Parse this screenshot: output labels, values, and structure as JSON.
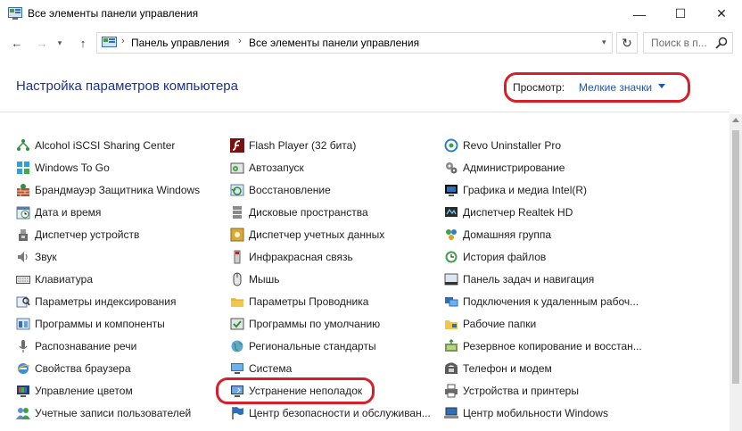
{
  "window": {
    "title": "Все элементы панели управления",
    "minimize": "—",
    "maximize": "☐",
    "close": "✕"
  },
  "nav": {
    "back": "←",
    "forward": "→",
    "recent": "▾",
    "up": "↑",
    "breadcrumb": [
      "Панель управления",
      "Все элементы панели управления"
    ],
    "separator": "›",
    "address_dropdown": "▾",
    "refresh": "↻",
    "search_placeholder": "Поиск в п..."
  },
  "header": {
    "title": "Настройка параметров компьютера",
    "view_label": "Просмотр:",
    "view_value": "Мелкие значки"
  },
  "columns": [
    [
      {
        "label": "Alcohol iSCSI Sharing Center",
        "icon": "network-share-icon"
      },
      {
        "label": "Windows To Go",
        "icon": "windows-to-go-icon"
      },
      {
        "label": "Брандмауэр Защитника Windows",
        "icon": "firewall-icon"
      },
      {
        "label": "Дата и время",
        "icon": "clock-icon"
      },
      {
        "label": "Диспетчер устройств",
        "icon": "device-manager-icon"
      },
      {
        "label": "Звук",
        "icon": "speaker-icon"
      },
      {
        "label": "Клавиатура",
        "icon": "keyboard-icon"
      },
      {
        "label": "Параметры индексирования",
        "icon": "indexing-icon"
      },
      {
        "label": "Программы и компоненты",
        "icon": "programs-icon"
      },
      {
        "label": "Распознавание речи",
        "icon": "microphone-icon"
      },
      {
        "label": "Свойства браузера",
        "icon": "browser-icon"
      },
      {
        "label": "Управление цветом",
        "icon": "color-management-icon"
      },
      {
        "label": "Учетные записи пользователей",
        "icon": "users-icon"
      }
    ],
    [
      {
        "label": "Flash Player (32 бита)",
        "icon": "flash-icon"
      },
      {
        "label": "Автозапуск",
        "icon": "autoplay-icon"
      },
      {
        "label": "Восстановление",
        "icon": "recovery-icon"
      },
      {
        "label": "Дисковые пространства",
        "icon": "storage-spaces-icon"
      },
      {
        "label": "Диспетчер учетных данных",
        "icon": "credential-icon"
      },
      {
        "label": "Инфракрасная связь",
        "icon": "infrared-icon"
      },
      {
        "label": "Мышь",
        "icon": "mouse-icon"
      },
      {
        "label": "Параметры Проводника",
        "icon": "folder-options-icon"
      },
      {
        "label": "Программы по умолчанию",
        "icon": "default-programs-icon"
      },
      {
        "label": "Региональные стандарты",
        "icon": "globe-icon"
      },
      {
        "label": "Система",
        "icon": "system-icon"
      },
      {
        "label": "Устранение неполадок",
        "icon": "troubleshooting-icon"
      },
      {
        "label": "Центр безопасности и обслуживан...",
        "icon": "flag-icon"
      }
    ],
    [
      {
        "label": "Revo Uninstaller Pro",
        "icon": "revo-icon"
      },
      {
        "label": "Администрирование",
        "icon": "admin-tools-icon"
      },
      {
        "label": "Графика и медиа Intel(R)",
        "icon": "intel-graphics-icon"
      },
      {
        "label": "Диспетчер Realtek HD",
        "icon": "realtek-icon"
      },
      {
        "label": "Домашняя группа",
        "icon": "homegroup-icon"
      },
      {
        "label": "История файлов",
        "icon": "file-history-icon"
      },
      {
        "label": "Панель задач и навигация",
        "icon": "taskbar-icon"
      },
      {
        "label": "Подключения к удаленным рабоч...",
        "icon": "remote-desktop-icon"
      },
      {
        "label": "Рабочие папки",
        "icon": "work-folders-icon"
      },
      {
        "label": "Резервное копирование и восстан...",
        "icon": "backup-icon"
      },
      {
        "label": "Телефон и модем",
        "icon": "phone-icon"
      },
      {
        "label": "Устройства и принтеры",
        "icon": "printer-icon"
      },
      {
        "label": "Центр мобильности Windows",
        "icon": "mobility-center-icon"
      }
    ]
  ],
  "colors": {
    "title_blue": "#1e3287",
    "link_blue": "#1a56b6",
    "highlight_red": "#d61f28"
  }
}
